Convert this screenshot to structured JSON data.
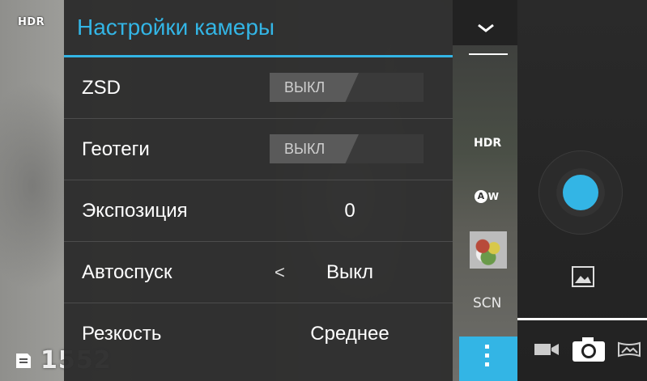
{
  "viewfinder": {
    "hdr_indicator": "HDR",
    "remaining_shots": "1552"
  },
  "settings": {
    "title": "Настройки камеры",
    "rows": [
      {
        "label": "ZSD",
        "type": "switch",
        "value": "ВЫКЛ"
      },
      {
        "label": "Геотеги",
        "type": "switch",
        "value": "ВЫКЛ"
      },
      {
        "label": "Экспозиция",
        "type": "value",
        "value": "0"
      },
      {
        "label": "Автоспуск",
        "type": "selector",
        "arrow": "<",
        "value": "Выкл"
      },
      {
        "label": "Резкость",
        "type": "value",
        "value": "Среднее"
      }
    ]
  },
  "strip": {
    "collapse_icon": "chevron-down-icon",
    "hdr": "HDR",
    "awb": "W",
    "awb_letter": "A",
    "scene": "SCN",
    "more_icon": "more-vertical-icon"
  },
  "controls": {
    "shutter_color": "#33b5e5",
    "accent": "#33b5e5"
  }
}
